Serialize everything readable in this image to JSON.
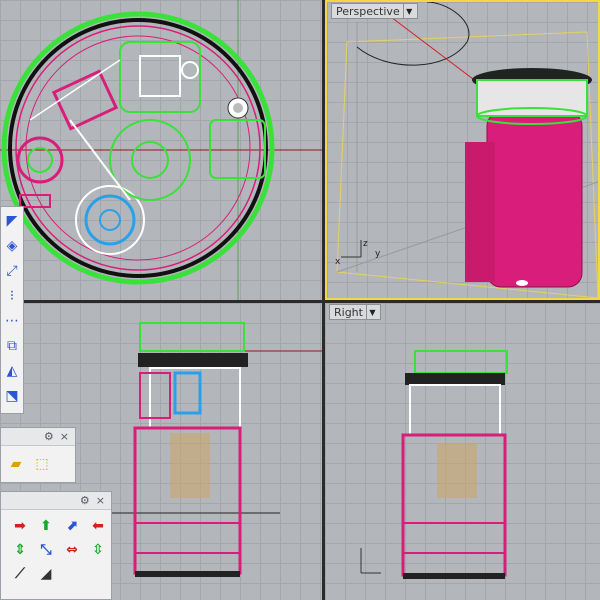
{
  "viewports": {
    "perspective": {
      "label": "Perspective"
    },
    "right": {
      "label": "Right"
    }
  },
  "axes": {
    "x": "x",
    "y": "y",
    "z": "z"
  },
  "colors": {
    "grid": "#b3b7bb",
    "wire_green": "#39e13a",
    "wire_magenta": "#d81e7a",
    "wire_white": "#ffffff",
    "wire_blue": "#2aa0e8",
    "highlight_border": "#f0d84a"
  },
  "panels": {
    "mid": {
      "gear_icon": "gear-icon",
      "close_icon": "close-icon"
    },
    "bottom": {
      "gear_icon": "gear-icon",
      "close_icon": "close-icon"
    }
  }
}
